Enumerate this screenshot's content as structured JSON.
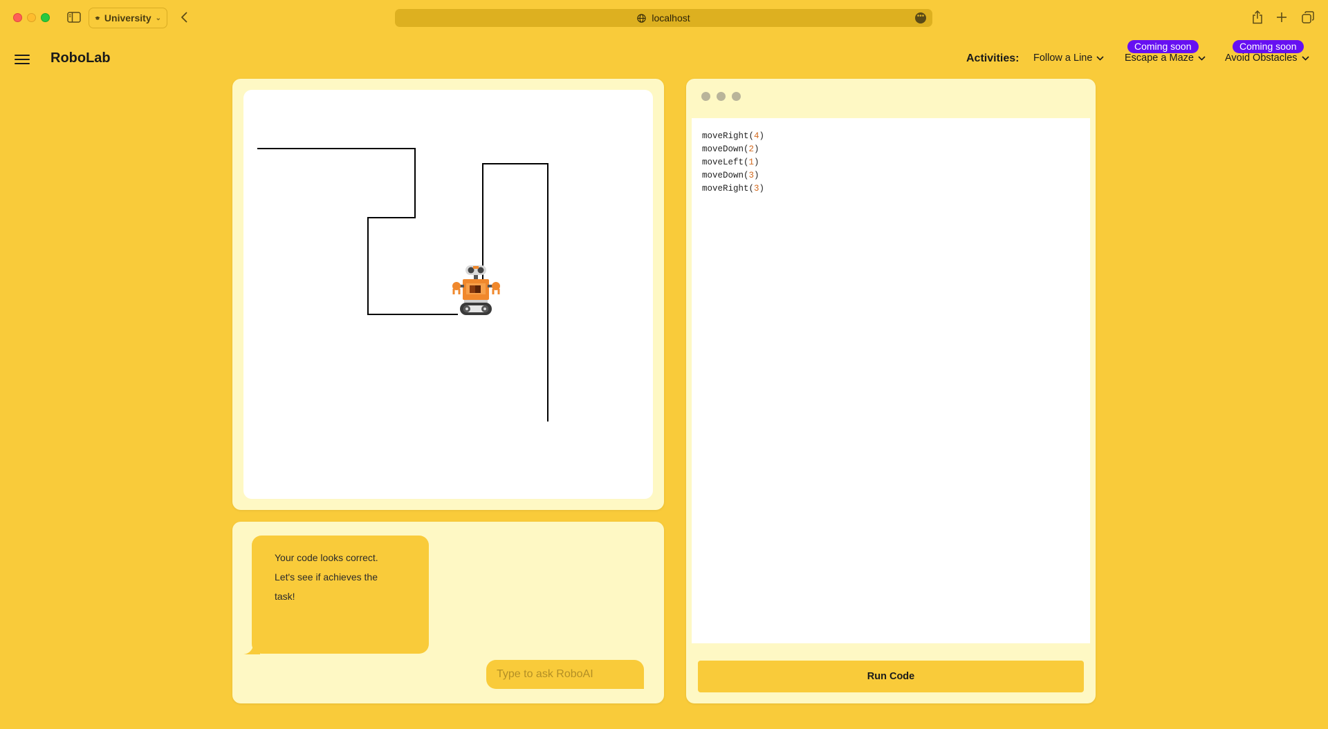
{
  "browser": {
    "profile_label": "University",
    "url": "localhost"
  },
  "header": {
    "brand": "RoboLab",
    "activities_label": "Activities:",
    "nav": [
      {
        "label": "Follow a Line",
        "badge": ""
      },
      {
        "label": "Escape a Maze",
        "badge": "Coming soon"
      },
      {
        "label": "Avoid Obstacles",
        "badge": "Coming soon"
      }
    ]
  },
  "colors": {
    "background": "#f9cb3a",
    "panel": "#fef8c4",
    "badge": "#6610f2",
    "path": "#000000",
    "robot_body": "#f0882c"
  },
  "chat": {
    "messages": [
      {
        "line1": "Your code looks correct.",
        "line2": "Let's see if achieves the",
        "line3": "task!"
      }
    ],
    "input_placeholder": "Type to ask RoboAI"
  },
  "editor": {
    "lines": [
      {
        "fn": "moveRight",
        "arg": "4"
      },
      {
        "fn": "moveDown",
        "arg": "2"
      },
      {
        "fn": "moveLeft",
        "arg": "1"
      },
      {
        "fn": "moveDown",
        "arg": "3"
      },
      {
        "fn": "moveRight",
        "arg": "3"
      }
    ],
    "run_label": "Run Code"
  }
}
